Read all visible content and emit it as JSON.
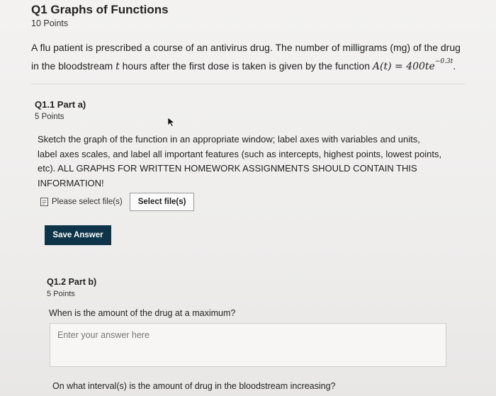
{
  "question": {
    "title": "Q1 Graphs of Functions",
    "points": "10 Points",
    "text_line1": "A flu patient is prescribed a course of an antivirus drug. The number of milligrams (mg) of the drug",
    "text_line2_pre": "in the bloodstream ",
    "text_var_t": "t",
    "text_line2_mid": " hours after the first dose is taken is given by the function ",
    "function_lhs": "A(t) = 400te",
    "function_exponent": "−0.3t",
    "function_end": "."
  },
  "part_a": {
    "title": "Q1.1 Part a)",
    "points": "5 Points",
    "line1": "Sketch the graph of the function in an appropriate window; label axes with variables and units,",
    "line2": "label axes scales, and label all important features (such as intercepts, highest points, lowest points,",
    "line3": "etc). ALL GRAPHS FOR WRITTEN HOMEWORK ASSIGNMENTS SHOULD CONTAIN THIS",
    "line4": "INFORMATION!",
    "file_label": "Please select file(s)",
    "select_button": "Select file(s)",
    "save_button": "Save Answer"
  },
  "part_b": {
    "title": "Q1.2 Part b)",
    "points": "5 Points",
    "question1": "When is the amount of the drug at a maximum?",
    "answer_placeholder": "Enter your answer here",
    "question2": "On what interval(s) is the amount of drug in the bloodstream increasing?"
  },
  "colors": {
    "save_button_bg": "#0d3448",
    "page_bg": "#efeeed"
  }
}
